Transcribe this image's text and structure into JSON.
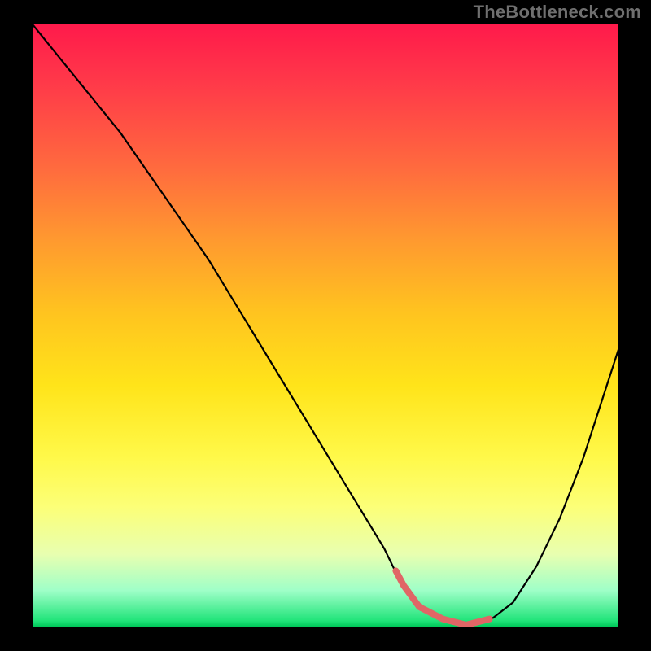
{
  "watermark": "TheBottleneck.com",
  "chart_data": {
    "type": "line",
    "title": "",
    "xlabel": "",
    "ylabel": "",
    "xlim": [
      0,
      100
    ],
    "ylim": [
      0,
      100
    ],
    "x": [
      0,
      5,
      10,
      15,
      20,
      25,
      30,
      35,
      40,
      45,
      50,
      55,
      60,
      63,
      66,
      70,
      74,
      78,
      82,
      86,
      90,
      94,
      100
    ],
    "values": [
      100,
      94,
      88,
      82,
      75,
      68,
      61,
      53,
      45,
      37,
      29,
      21,
      13,
      7,
      3,
      1,
      0,
      1,
      4,
      10,
      18,
      28,
      46
    ],
    "marker_range_x": [
      62,
      78
    ],
    "gradient_colors": {
      "top": "#ff1a4b",
      "mid_upper": "#ff9a2f",
      "mid": "#ffe41a",
      "mid_lower": "#fcff77",
      "bottom": "#00c85a"
    }
  }
}
